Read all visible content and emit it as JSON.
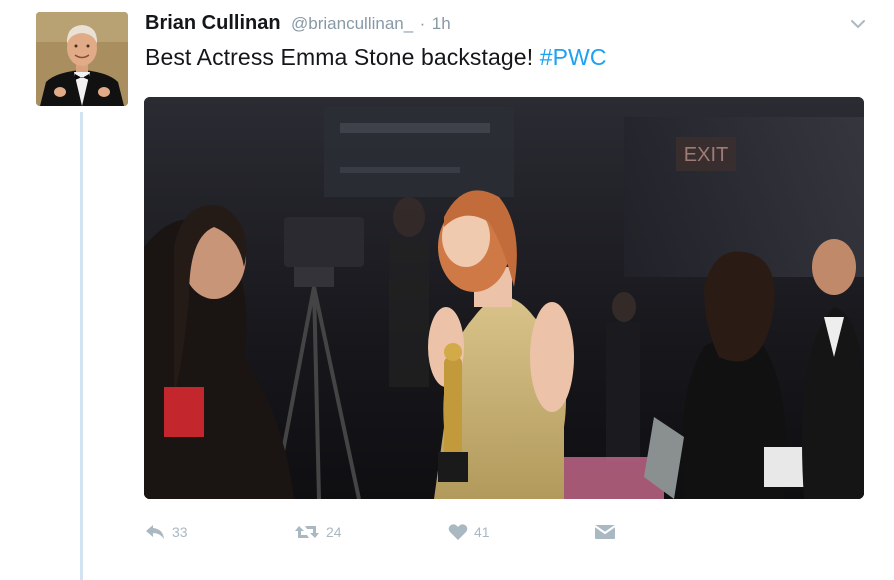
{
  "tweet": {
    "author": {
      "display_name": "Brian Cullinan",
      "handle": "@briancullinan_",
      "separator": "·",
      "time": "1h"
    },
    "text": "Best Actress Emma Stone backstage! ",
    "hashtag": "#PWC",
    "photo": {
      "signs": [
        "EXIT"
      ]
    },
    "actions": {
      "reply_count": "33",
      "retweet_count": "24",
      "like_count": "41"
    }
  },
  "colors": {
    "hashtag": "#1da1f2",
    "secondary_text": "#8899a6",
    "action_icons": "#aab8c2",
    "thread_line": "#d4e3f2"
  },
  "icons": [
    "caret-down-icon",
    "reply-icon",
    "retweet-icon",
    "heart-icon",
    "direct-message-icon"
  ]
}
